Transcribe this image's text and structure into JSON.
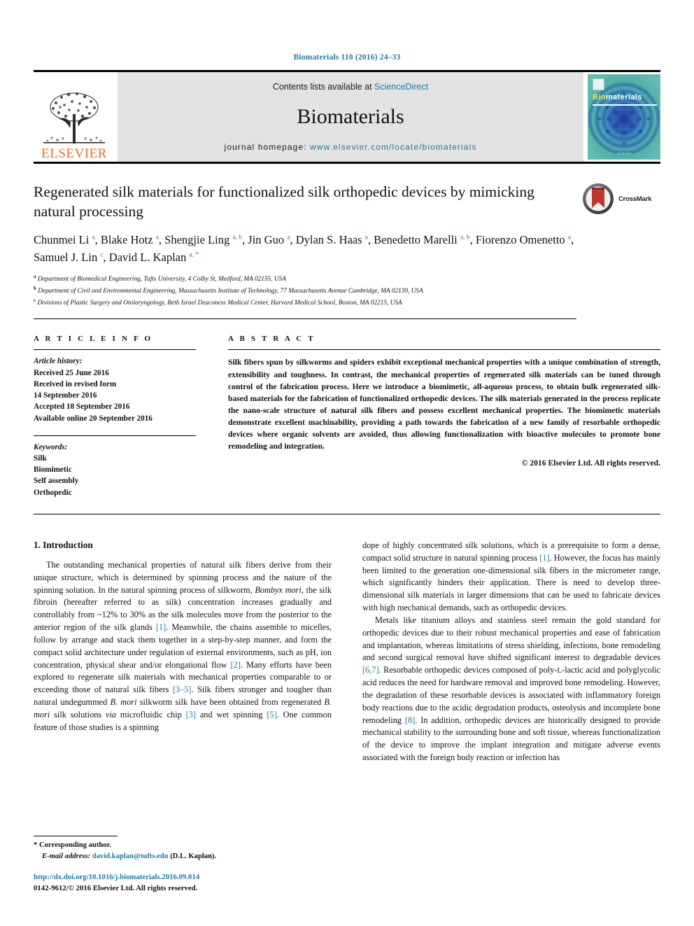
{
  "running_head": "Biomaterials 110 (2016) 24–33",
  "masthead": {
    "publisher": "ELSEVIER",
    "contents_prefix": "Contents lists available at ",
    "contents_link": "ScienceDirect",
    "journal_name": "Biomaterials",
    "homepage_prefix": "journal homepage: ",
    "homepage_link": "www.elsevier.com/locate/biomaterials",
    "cover": {
      "title_first": "Bio",
      "title_rest": "materials",
      "footer": "ELSEVIER"
    }
  },
  "article": {
    "title": "Regenerated silk materials for functionalized silk orthopedic devices by mimicking natural processing",
    "crossmark_label": "CrossMark",
    "authors_html": "Chunmei Li <sup>a</sup>, Blake Hotz <sup>a</sup>, Shengjie Ling <sup>a, b</sup>, Jin Guo <sup>a</sup>, Dylan S. Haas <sup>a</sup>, Benedetto Marelli <sup>a, b</sup>, Fiorenzo Omenetto <sup>a</sup>, Samuel J. Lin <sup>c</sup>, David L. Kaplan <sup>a, *</sup>",
    "affiliations": [
      {
        "mark": "a",
        "text": "Department of Biomedical Engineering, Tufts University, 4 Colby St, Medford, MA 02155, USA"
      },
      {
        "mark": "b",
        "text": "Department of Civil and Environmental Engineering, Massachusetts Institute of Technology, 77 Massachusetts Avenue Cambridge, MA 02139, USA"
      },
      {
        "mark": "c",
        "text": "Divisions of Plastic Surgery and Otolaryngology, Beth Israel Deaconess Medical Center, Harvard Medical School, Boston, MA 02215, USA"
      }
    ]
  },
  "article_info": {
    "heading": "A R T I C L E  I N F O",
    "history_label": "Article history:",
    "history_lines": [
      "Received 25 June 2016",
      "Received in revised form",
      "14 September 2016",
      "Accepted 18 September 2016",
      "Available online 20 September 2016"
    ],
    "keywords_label": "Keywords:",
    "keywords": [
      "Silk",
      "Biomimetic",
      "Self assembly",
      "Orthopedic"
    ]
  },
  "abstract": {
    "heading": "A B S T R A C T",
    "text": "Silk fibers spun by silkworms and spiders exhibit exceptional mechanical properties with a unique combination of strength, extensibility and toughness. In contrast, the mechanical properties of regenerated silk materials can be tuned through control of the fabrication process. Here we introduce a biomimetic, all-aqueous process, to obtain bulk regenerated silk-based materials for the fabrication of functionalized orthopedic devices. The silk materials generated in the process replicate the nano-scale structure of natural silk fibers and possess excellent mechanical properties. The biomimetic materials demonstrate excellent machinability, providing a path towards the fabrication of a new family of resorbable orthopedic devices where organic solvents are avoided, thus allowing functionalization with bioactive molecules to promote bone remodeling and integration.",
    "copyright": "© 2016 Elsevier Ltd. All rights reserved."
  },
  "body": {
    "section_heading": "1. Introduction",
    "left_paragraphs_html": [
      "The outstanding mechanical properties of natural silk fibers derive from their unique structure, which is determined by spinning process and the nature of the spinning solution. In the natural spinning process of silkworm, <i>Bombyx mori</i>, the silk fibroin (hereafter referred to as silk) concentration increases gradually and controllably from ~12% to 30% as the silk molecules move from the posterior to the anterior region of the silk glands <span class=\"ref\">[1]</span>. Meanwhile, the chains assemble to micelles, follow by arrange and stack them together in a step-by-step manner, and form the compact solid architecture under regulation of external environments, such as pH, ion concentration, physical shear and/or elongational flow <span class=\"ref\">[2]</span>. Many efforts have been explored to regenerate silk materials with mechanical properties comparable to or exceeding those of natural silk fibers <span class=\"ref\">[3&#8211;5]</span>. Silk fibers stronger and tougher than natural undegummed <i>B. mori</i> silkworm silk have been obtained from regenerated <i>B. mori</i> silk solutions <i>via</i> microfluidic chip <span class=\"ref\">[3]</span> and wet spinning <span class=\"ref\">[5]</span>. One common feature of those studies is a spinning"
    ],
    "right_paragraphs_html": [
      "dope of highly concentrated silk solutions, which is a prerequisite to form a dense, compact solid structure in natural spinning process <span class=\"ref\">[1]</span>. However, the focus has mainly been limited to the generation one-dimensional silk fibers in the micrometer range, which significantly hinders their application. There is need to develop three-dimensional silk materials in larger dimensions that can be used to fabricate devices with high mechanical demands, such as orthopedic devices.",
      "Metals like titanium alloys and stainless steel remain the gold standard for orthopedic devices due to their robust mechanical properties and ease of fabrication and implantation, whereas limitations of stress shielding, infections, bone remodeling and second surgical removal have shifted significant interest to degradable devices <span class=\"ref\">[6,7]</span>. Resorbable orthopedic devices composed of poly-<span class=\"sc\">L</span>-lactic acid and polyglycolic acid reduces the need for hardware removal and improved bone remodeling. However, the degradation of these resorbable devices is associated with inflammatory foreign body reactions due to the acidic degradation products, osteolysis and incomplete bone remodeling <span class=\"ref\">[8]</span>. In addition, orthopedic devices are historically designed to provide mechanical stability to the surrounding bone and soft tissue, whereas functionalization of the device to improve the implant integration and mitigate adverse events associated with the foreign body reaction or infection has"
    ]
  },
  "footnote": {
    "corresponding": "* Corresponding author.",
    "email_label": "E-mail address:",
    "email": "david.kaplan@tufts.edu",
    "email_suffix": " (D.L. Kaplan).",
    "doi": "http://dx.doi.org/10.1016/j.biomaterials.2016.09.014",
    "issn": "0142-9612/© 2016 Elsevier Ltd. All rights reserved."
  },
  "colors": {
    "link": "#1a7ba5",
    "elsevier_orange": "#E9711C",
    "cover_teal": "#3fa2a8"
  }
}
